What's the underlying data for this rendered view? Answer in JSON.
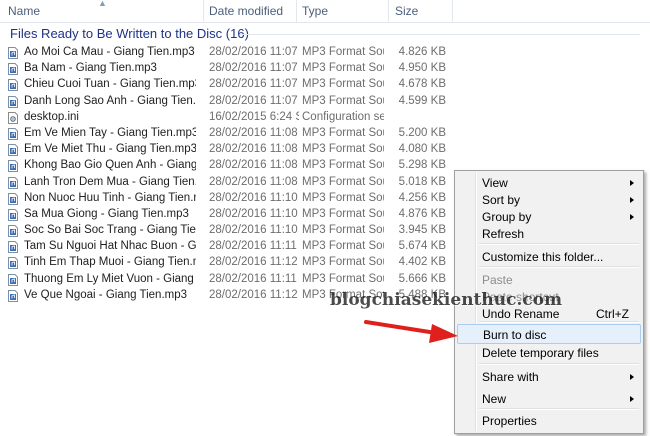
{
  "columns": {
    "name": "Name",
    "date": "Date modified",
    "type": "Type",
    "size": "Size"
  },
  "group": {
    "title": "Files Ready to Be Written to the Disc (16)"
  },
  "files": [
    {
      "name": "Ao Moi Ca Mau - Giang Tien.mp3",
      "date": "28/02/2016 11:07 ...",
      "type": "MP3 Format Sound",
      "size": "4.826 KB",
      "icon": "audio-file-icon"
    },
    {
      "name": "Ba Nam - Giang Tien.mp3",
      "date": "28/02/2016 11:07 ...",
      "type": "MP3 Format Sound",
      "size": "4.950 KB",
      "icon": "audio-file-icon"
    },
    {
      "name": "Chieu Cuoi Tuan - Giang Tien.mp3",
      "date": "28/02/2016 11:07 ...",
      "type": "MP3 Format Sound",
      "size": "4.678 KB",
      "icon": "audio-file-icon"
    },
    {
      "name": "Danh Long Sao Anh - Giang Tien.mp3",
      "date": "28/02/2016 11:07 ...",
      "type": "MP3 Format Sound",
      "size": "4.599 KB",
      "icon": "audio-file-icon"
    },
    {
      "name": "desktop.ini",
      "date": "16/02/2015 6:24 SA",
      "type": "Configuration sett...",
      "size": "",
      "icon": "settings-file-icon"
    },
    {
      "name": "Em Ve Mien Tay - Giang Tien.mp3",
      "date": "28/02/2016 11:08 ...",
      "type": "MP3 Format Sound",
      "size": "5.200 KB",
      "icon": "audio-file-icon"
    },
    {
      "name": "Em Ve Miet Thu - Giang Tien.mp3",
      "date": "28/02/2016 11:08 ...",
      "type": "MP3 Format Sound",
      "size": "4.080 KB",
      "icon": "audio-file-icon"
    },
    {
      "name": "Khong Bao Gio Quen Anh - Giang Tien....",
      "date": "28/02/2016 11:08 ...",
      "type": "MP3 Format Sound",
      "size": "5.298 KB",
      "icon": "audio-file-icon"
    },
    {
      "name": "Lanh Tron Dem Mua - Giang Tien.mp3",
      "date": "28/02/2016 11:08 ...",
      "type": "MP3 Format Sound",
      "size": "5.018 KB",
      "icon": "audio-file-icon"
    },
    {
      "name": "Non Nuoc Huu Tinh - Giang Tien.mp3",
      "date": "28/02/2016 11:10 ...",
      "type": "MP3 Format Sound",
      "size": "4.256 KB",
      "icon": "audio-file-icon"
    },
    {
      "name": "Sa Mua Giong - Giang Tien.mp3",
      "date": "28/02/2016 11:10 ...",
      "type": "MP3 Format Sound",
      "size": "4.876 KB",
      "icon": "audio-file-icon"
    },
    {
      "name": "Soc So Bai Soc Trang - Giang Tien.mp3",
      "date": "28/02/2016 11:10 ...",
      "type": "MP3 Format Sound",
      "size": "3.945 KB",
      "icon": "audio-file-icon"
    },
    {
      "name": "Tam Su Nguoi Hat Nhac Buon - Giang Ti...",
      "date": "28/02/2016 11:11 ...",
      "type": "MP3 Format Sound",
      "size": "5.674 KB",
      "icon": "audio-file-icon"
    },
    {
      "name": "Tinh Em Thap Muoi - Giang Tien.mp3",
      "date": "28/02/2016 11:12 ...",
      "type": "MP3 Format Sound",
      "size": "4.402 KB",
      "icon": "audio-file-icon"
    },
    {
      "name": "Thuong Em Ly Miet Vuon - Giang Tien.mp3",
      "date": "28/02/2016 11:11 ...",
      "type": "MP3 Format Sound",
      "size": "5.666 KB",
      "icon": "audio-file-icon"
    },
    {
      "name": "Ve Que Ngoai - Giang Tien.mp3",
      "date": "28/02/2016 11:12 ...",
      "type": "MP3 Format Sound",
      "size": "5.488 KB",
      "icon": "audio-file-icon"
    }
  ],
  "context_menu": {
    "items": [
      {
        "label": "View",
        "submenu": true
      },
      {
        "label": "Sort by",
        "submenu": true
      },
      {
        "label": "Group by",
        "submenu": true
      },
      {
        "label": "Refresh"
      },
      {
        "label": "Customize this folder..."
      },
      {
        "label": "Paste",
        "disabled": true
      },
      {
        "label": "Paste shortcut",
        "disabled": true
      },
      {
        "label": "Undo Rename",
        "shortcut": "Ctrl+Z"
      },
      {
        "label": "Burn to disc",
        "highlighted": true
      },
      {
        "label": "Delete temporary files"
      },
      {
        "label": "Share with",
        "submenu": true
      },
      {
        "label": "New",
        "submenu": true
      },
      {
        "label": "Properties"
      }
    ]
  },
  "watermark": "blogchiasekienthuc.com",
  "colors": {
    "group_title": "#1e3287",
    "column_header": "#4c607a",
    "menu_highlight": "#e5f0fb",
    "annotation_arrow": "#e0201c"
  }
}
